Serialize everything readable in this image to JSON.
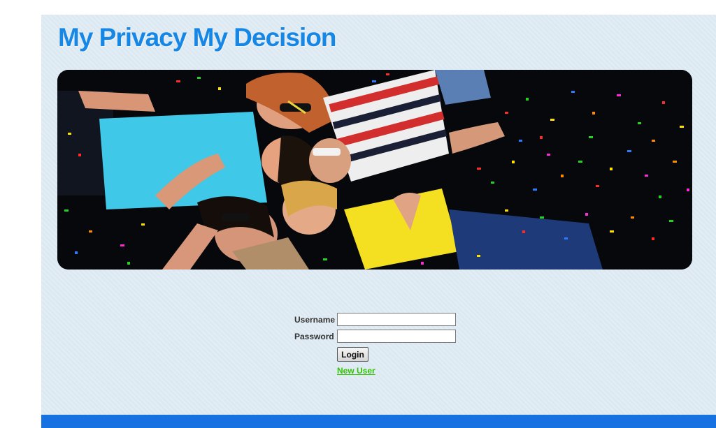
{
  "site": {
    "title": "My Privacy My Decision",
    "title_color": "#1787e6"
  },
  "banner": {
    "image_description_icon": "party-photo-image"
  },
  "login": {
    "username_label": "Username",
    "username_value": "",
    "password_label": "Password",
    "password_value": "",
    "login_button": "Login",
    "new_user_link": "New User"
  },
  "colors": {
    "page_bg": "#dde9f2",
    "footer": "#1672e0",
    "link": "#32c400"
  }
}
